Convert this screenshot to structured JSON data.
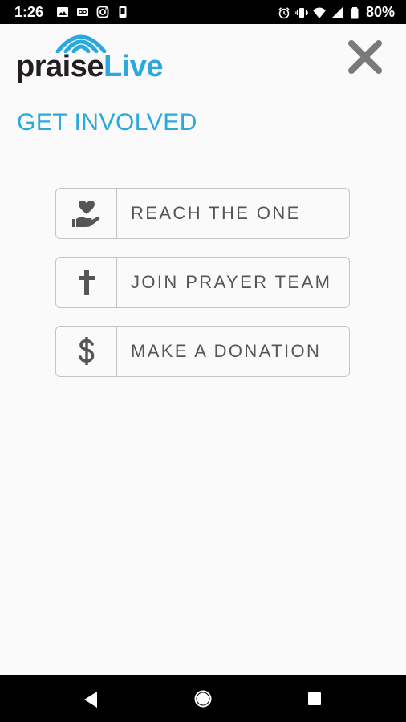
{
  "status_bar": {
    "time": "1:26",
    "battery": "80%",
    "left_icons": [
      "image-icon",
      "voicemail-icon",
      "instagram-icon",
      "device-icon"
    ],
    "right_icons": [
      "alarm-icon",
      "vibrate-icon",
      "wifi-icon",
      "signal-icon",
      "battery-icon"
    ]
  },
  "header": {
    "logo_praise": "praise",
    "logo_live": "Live",
    "close_icon": "close-icon"
  },
  "page_title": "GET INVOLVED",
  "actions": [
    {
      "label": "REACH THE ONE",
      "icon": "hand-heart-icon"
    },
    {
      "label": "JOIN PRAYER TEAM",
      "icon": "cross-icon"
    },
    {
      "label": "MAKE A DONATION",
      "icon": "dollar-icon"
    }
  ],
  "nav_bar": {
    "icons": [
      "back-icon",
      "home-icon",
      "recents-icon"
    ]
  },
  "colors": {
    "accent": "#2aa9df",
    "logo_dark": "#231f20",
    "button_border": "#c4c4c4",
    "icon_gray": "#555555",
    "background": "#fafafa"
  }
}
